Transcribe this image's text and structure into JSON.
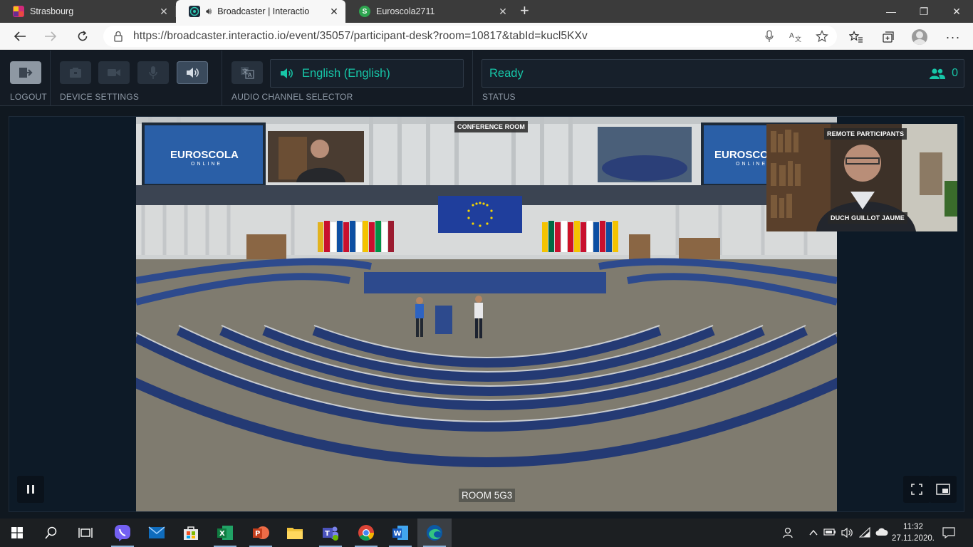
{
  "browser": {
    "tabs": [
      {
        "title": "Strasbourg",
        "active": false
      },
      {
        "title": "Broadcaster | Interactio",
        "active": true
      },
      {
        "title": "Euroscola2711",
        "active": false
      }
    ],
    "url": "https://broadcaster.interactio.io/event/35057/participant-desk?room=10817&tabId=kucl5KXv"
  },
  "toolbar": {
    "logout_label": "LOGOUT",
    "device_settings_label": "DEVICE SETTINGS",
    "audio_channel_label": "AUDIO CHANNEL SELECTOR",
    "status_label": "STATUS",
    "channel_value": "English (English)",
    "status_value": "Ready",
    "participant_count": "0"
  },
  "video": {
    "conference_tag": "CONFERENCE ROOM",
    "remote_tag": "REMOTE PARTICIPANTS",
    "speaker_name": "DUCH GUILLOT JAUME",
    "room_label": "ROOM 5G3",
    "screen_text_left": "EUROSCOLA",
    "screen_sub_left": "ONLINE",
    "screen_text_right": "EUROSCOLA",
    "screen_sub_right": "ONLINE"
  },
  "taskbar": {
    "apps": [
      "viber-icon",
      "mail-icon",
      "store-icon",
      "excel-icon",
      "powerpoint-icon",
      "file-explorer-icon",
      "teams-icon",
      "chrome-icon",
      "word-icon",
      "edge-icon"
    ],
    "time": "11:32",
    "date": "27.11.2020."
  },
  "colors": {
    "accent": "#17c6a8",
    "app_bg": "#141b24"
  }
}
